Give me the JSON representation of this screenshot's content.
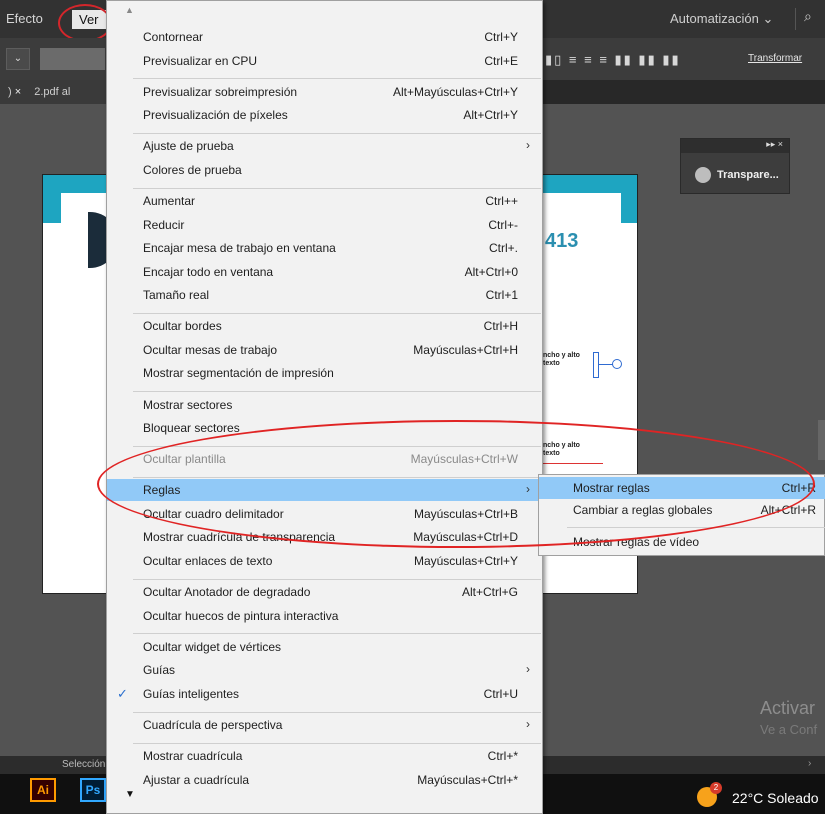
{
  "menubar": {
    "efecto": "Efecto",
    "ver": "Ver",
    "workspace": "Automatización",
    "workspace_chevron": "⌄",
    "search_glyph": "⌕"
  },
  "controlbar": {
    "dropdown_glyph": "⌄",
    "align_glyphs": "▮▯ ≡ ≡ ≡  ▮▮ ▮▮ ▮▮",
    "transformar": "Transformar"
  },
  "tabbar": {
    "close": "×",
    "doc_prefix": ")",
    "doc_name": "2.pdf al"
  },
  "artboard": {
    "number": "413",
    "text1": "ncho y alto\ntexto",
    "text2": "ncho y alto\ntexto"
  },
  "panel": {
    "head": "▸▸  ×",
    "label": "Transpare..."
  },
  "watermark": {
    "line1": "Activar",
    "line2": "Ve a Conf"
  },
  "statusbar": {
    "selection": "Selección",
    "arrow": "›"
  },
  "taskbar": {
    "ai": "Ai",
    "ps": "Ps",
    "badge": "2",
    "weather": "22°C  Soleado"
  },
  "menu": {
    "scroll_up": "▲",
    "scroll_down": "▼",
    "groups": [
      [
        {
          "label": "Contornear",
          "shortcut": "Ctrl+Y"
        },
        {
          "label": "Previsualizar en CPU",
          "shortcut": "Ctrl+E"
        }
      ],
      [
        {
          "label": "Previsualizar sobreimpresión",
          "shortcut": "Alt+Mayúsculas+Ctrl+Y"
        },
        {
          "label": "Previsualización de píxeles",
          "shortcut": "Alt+Ctrl+Y"
        }
      ],
      [
        {
          "label": "Ajuste de prueba",
          "shortcut": "",
          "submenu": true
        },
        {
          "label": "Colores de prueba",
          "shortcut": ""
        }
      ],
      [
        {
          "label": "Aumentar",
          "shortcut": "Ctrl++"
        },
        {
          "label": "Reducir",
          "shortcut": "Ctrl+-"
        },
        {
          "label": "Encajar mesa de trabajo en ventana",
          "shortcut": "Ctrl+."
        },
        {
          "label": "Encajar todo en ventana",
          "shortcut": "Alt+Ctrl+0"
        },
        {
          "label": "Tamaño real",
          "shortcut": "Ctrl+1"
        }
      ],
      [
        {
          "label": "Ocultar bordes",
          "shortcut": "Ctrl+H"
        },
        {
          "label": "Ocultar mesas de trabajo",
          "shortcut": "Mayúsculas+Ctrl+H"
        },
        {
          "label": "Mostrar segmentación de impresión",
          "shortcut": ""
        }
      ],
      [
        {
          "label": "Mostrar sectores",
          "shortcut": ""
        },
        {
          "label": "Bloquear sectores",
          "shortcut": ""
        }
      ],
      [
        {
          "label": "Ocultar plantilla",
          "shortcut": "Mayúsculas+Ctrl+W",
          "disabled": true
        }
      ],
      [
        {
          "label": "Reglas",
          "shortcut": "",
          "submenu": true,
          "highlight": true
        },
        {
          "label": "Ocultar cuadro delimitador",
          "shortcut": "Mayúsculas+Ctrl+B"
        },
        {
          "label": "Mostrar cuadrícula de transparencia",
          "shortcut": "Mayúsculas+Ctrl+D"
        },
        {
          "label": "Ocultar enlaces de texto",
          "shortcut": "Mayúsculas+Ctrl+Y"
        }
      ],
      [
        {
          "label": "Ocultar Anotador de degradado",
          "shortcut": "Alt+Ctrl+G"
        },
        {
          "label": "Ocultar huecos de pintura interactiva",
          "shortcut": ""
        }
      ],
      [
        {
          "label": "Ocultar widget de vértices",
          "shortcut": ""
        },
        {
          "label": "Guías",
          "shortcut": "",
          "submenu": true
        },
        {
          "label": "Guías inteligentes",
          "shortcut": "Ctrl+U",
          "checked": true
        }
      ],
      [
        {
          "label": "Cuadrícula de perspectiva",
          "shortcut": "",
          "submenu": true
        }
      ],
      [
        {
          "label": "Mostrar cuadrícula",
          "shortcut": "Ctrl+*"
        },
        {
          "label": "Ajustar a cuadrícula",
          "shortcut": "Mayúsculas+Ctrl+*"
        }
      ]
    ]
  },
  "submenu": {
    "items": [
      {
        "label": "Mostrar reglas",
        "shortcut": "Ctrl+R",
        "highlight": true
      },
      {
        "label": "Cambiar a reglas globales",
        "shortcut": "Alt+Ctrl+R"
      },
      {
        "label": "Mostrar reglas de vídeo",
        "shortcut": ""
      }
    ]
  },
  "colors": {
    "highlight": "#91c9f7",
    "annotation_red": "#e02424",
    "menu_bg": "#f2f2f2",
    "app_bg": "#535353"
  }
}
